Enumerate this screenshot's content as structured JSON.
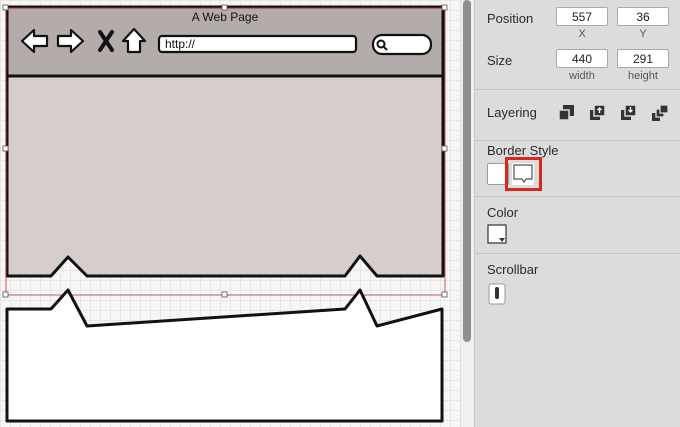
{
  "canvas": {
    "browser_title": "A Web Page",
    "url": "http://"
  },
  "inspector": {
    "position": {
      "label": "Position",
      "x": "557",
      "y": "36",
      "x_label": "X",
      "y_label": "Y"
    },
    "size": {
      "label": "Size",
      "width": "440",
      "height": "291",
      "width_label": "width",
      "height_label": "height"
    },
    "layering": {
      "label": "Layering",
      "buttons": [
        "bring-to-front-icon",
        "bring-forward-icon",
        "send-backward-icon",
        "send-to-back-icon"
      ]
    },
    "border_style": {
      "label": "Border Style",
      "options": [
        "plain-border-icon",
        "torn-border-icon"
      ],
      "selected": "torn-border-icon",
      "highlight_color": "#d7271f"
    },
    "color": {
      "label": "Color"
    },
    "scrollbar": {
      "label": "Scrollbar"
    }
  }
}
